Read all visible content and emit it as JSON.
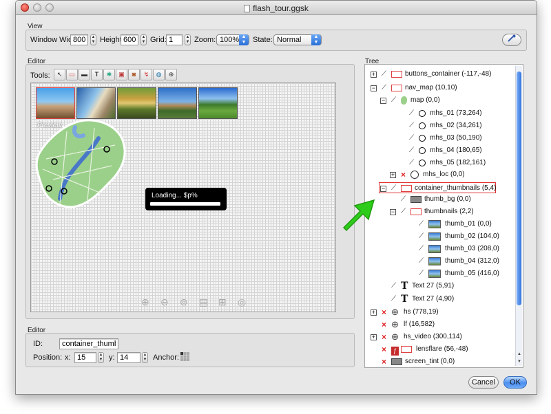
{
  "window": {
    "title": "flash_tour.ggsk"
  },
  "view": {
    "label": "View",
    "width_label": "Window Width:",
    "width_value": "800",
    "height_label": "Height:",
    "height_value": "600",
    "grid_label": "Grid:",
    "grid_value": "1",
    "zoom_label": "Zoom:",
    "zoom_value": "100%",
    "state_label": "State:",
    "state_value": "Normal"
  },
  "editor": {
    "label": "Editor",
    "tools_label": "Tools:",
    "tools": [
      "select-tool-icon",
      "rectangle-tool-icon",
      "button-tool-icon",
      "text-tool-icon",
      "image-tool-icon",
      "hotspot-tool-icon",
      "cloner-tool-icon",
      "timer-tool-icon",
      "browser-tool-icon",
      "crosshair-tool-icon"
    ],
    "preview_label": "Preview",
    "loading_text": "Loading... $p%",
    "loading_progress": 1.0,
    "bottom_icons": [
      "zoom-in-icon",
      "zoom-out-icon",
      "autorotate-icon",
      "info-icon",
      "fullscreen-icon",
      "target-icon"
    ]
  },
  "props": {
    "label": "Editor",
    "id_label": "ID:",
    "id_value": "container_thumbnails",
    "position_label": "Position:",
    "x_label": "x:",
    "x_value": "15",
    "y_label": "y:",
    "y_value": "14",
    "anchor_label": "Anchor:"
  },
  "tree": {
    "label": "Tree",
    "items": [
      {
        "label": "buttons_container (-117,-48)"
      },
      {
        "label": "nav_map (10,10)"
      },
      {
        "label": "map (0,0)"
      },
      {
        "label": "mhs_01 (73,264)"
      },
      {
        "label": "mhs_02 (34,261)"
      },
      {
        "label": "mhs_03 (50,190)"
      },
      {
        "label": "mhs_04 (180,65)"
      },
      {
        "label": "mhs_05 (182,161)"
      },
      {
        "label": "mhs_loc (0,0)"
      },
      {
        "label": "container_thumbnails (5,4)"
      },
      {
        "label": "thumb_bg (0,0)"
      },
      {
        "label": "thumbnails (2,2)"
      },
      {
        "label": "thumb_01 (0,0)"
      },
      {
        "label": "thumb_02 (104,0)"
      },
      {
        "label": "thumb_03 (208,0)"
      },
      {
        "label": "thumb_04 (312,0)"
      },
      {
        "label": "thumb_05 (416,0)"
      },
      {
        "label": "Text 27 (5,91)"
      },
      {
        "label": "Text 27 (4,90)"
      },
      {
        "label": "hs (778,19)"
      },
      {
        "label": "lf (16,582)"
      },
      {
        "label": "hs_video (300,114)"
      },
      {
        "label": "lensflare (56,-48)"
      },
      {
        "label": "screen_tint (0,0)"
      }
    ]
  },
  "buttons": {
    "cancel": "Cancel",
    "ok": "OK"
  },
  "colors": {
    "accent": "#2f73db",
    "highlight_border": "#e03030",
    "arrow": "#2ecc1a",
    "map_green": "#9bd08a"
  }
}
